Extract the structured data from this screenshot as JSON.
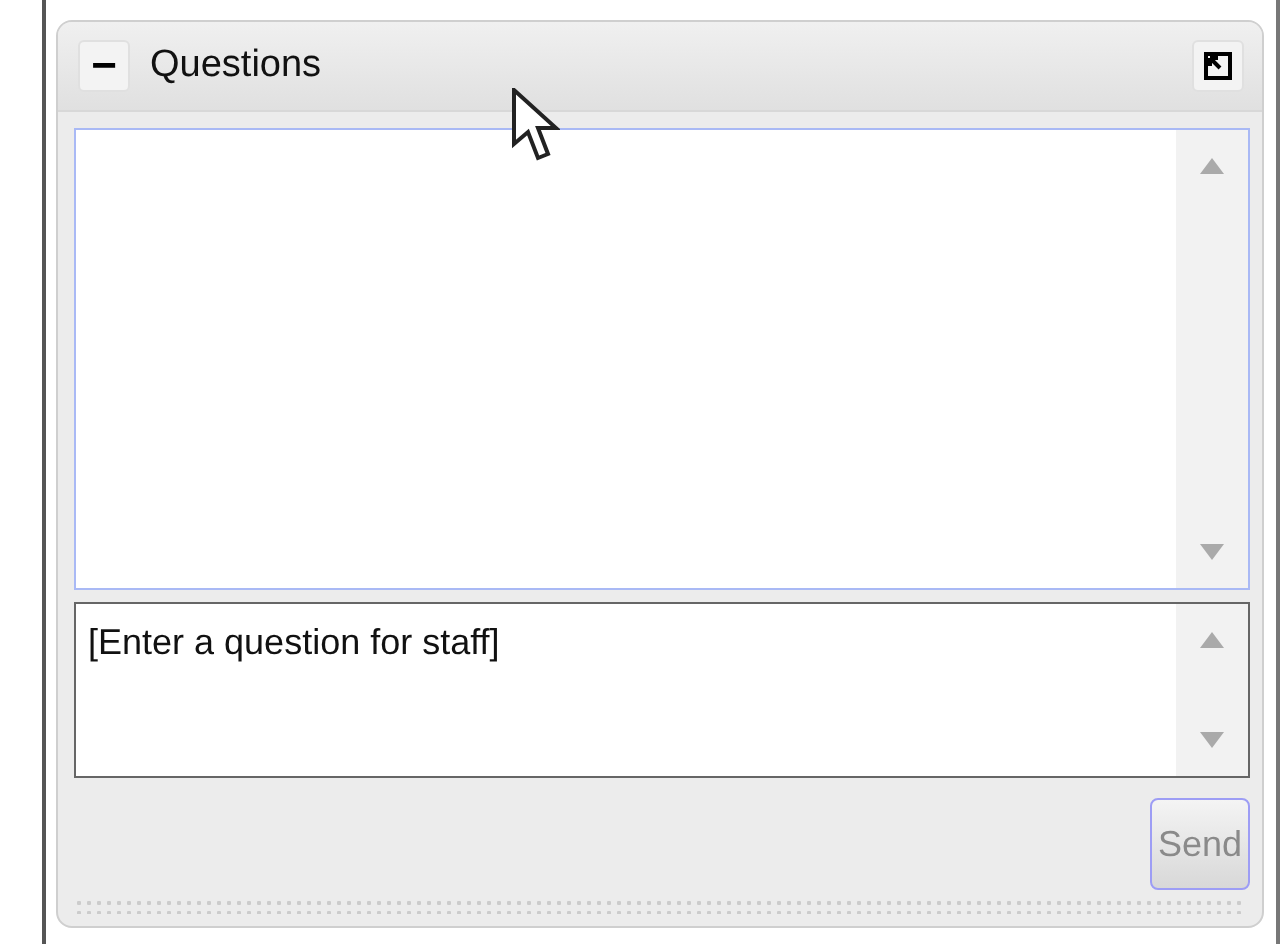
{
  "panel": {
    "title": "Questions",
    "collapse_glyph": "−",
    "expanded": true
  },
  "question_input": {
    "value": "[Enter a question for staff]"
  },
  "send_button": {
    "label": "Send",
    "disabled": true
  }
}
